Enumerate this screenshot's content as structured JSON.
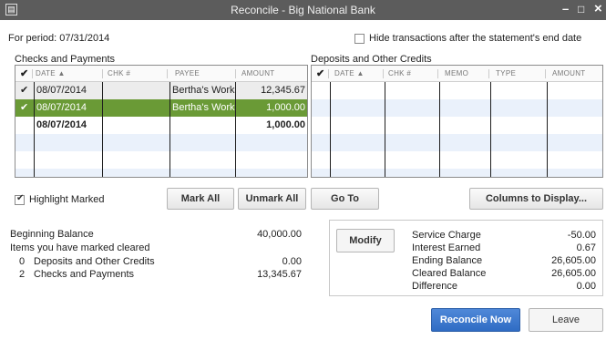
{
  "title_bar": {
    "title": "Reconcile - Big National Bank",
    "minimize": "–",
    "maximize": "□",
    "close": "×"
  },
  "period": "For period: 07/31/2014",
  "hide_after_end_date": {
    "label": "Hide transactions after the statement's end date",
    "checked": false
  },
  "checks": {
    "label": "Checks and Payments",
    "columns": {
      "check": "✔",
      "date": "DATE ▲",
      "chk": "CHK #",
      "payee": "PAYEE",
      "amount": "AMOUNT"
    },
    "rows": [
      {
        "mark": "✔",
        "date": "08/07/2014",
        "chk": "",
        "payee": "Bertha's Work...",
        "amount": "12,345.67"
      },
      {
        "mark": "✔",
        "date": "08/07/2014",
        "chk": "",
        "payee": "Bertha's Work...",
        "amount": "1,000.00"
      },
      {
        "mark": "",
        "date": "08/07/2014",
        "chk": "",
        "payee": "",
        "amount": "1,000.00"
      }
    ]
  },
  "deposits": {
    "label": "Deposits and Other Credits",
    "columns": {
      "check": "✔",
      "date": "DATE ▲",
      "chk": "CHK #",
      "memo": "MEMO",
      "type": "TYPE",
      "amount": "AMOUNT"
    }
  },
  "highlight_marked": {
    "label": "Highlight Marked",
    "checked": true
  },
  "buttons": {
    "mark_all": "Mark All",
    "unmark_all": "Unmark All",
    "go_to": "Go To",
    "columns_to_display": "Columns to Display...",
    "modify": "Modify",
    "reconcile_now": "Reconcile Now",
    "leave": "Leave"
  },
  "summary_left": {
    "beginning_balance_label": "Beginning Balance",
    "beginning_balance": "40,000.00",
    "items_marked_label": "Items you have marked cleared",
    "deposits_count": "0",
    "deposits_label": "Deposits and Other Credits",
    "deposits_value": "0.00",
    "checks_count": "2",
    "checks_label": "Checks and Payments",
    "checks_value": "13,345.67"
  },
  "summary_right": {
    "service_charge_label": "Service Charge",
    "service_charge": "-50.00",
    "interest_earned_label": "Interest Earned",
    "interest_earned": "0.67",
    "ending_balance_label": "Ending Balance",
    "ending_balance": "26,605.00",
    "cleared_balance_label": "Cleared Balance",
    "cleared_balance": "26,605.00",
    "difference_label": "Difference",
    "difference": "0.00"
  },
  "colors": {
    "selected_row": "#6a9a36",
    "alt_row": "#eaf1fb",
    "primary_button": "#2f6cc4"
  }
}
